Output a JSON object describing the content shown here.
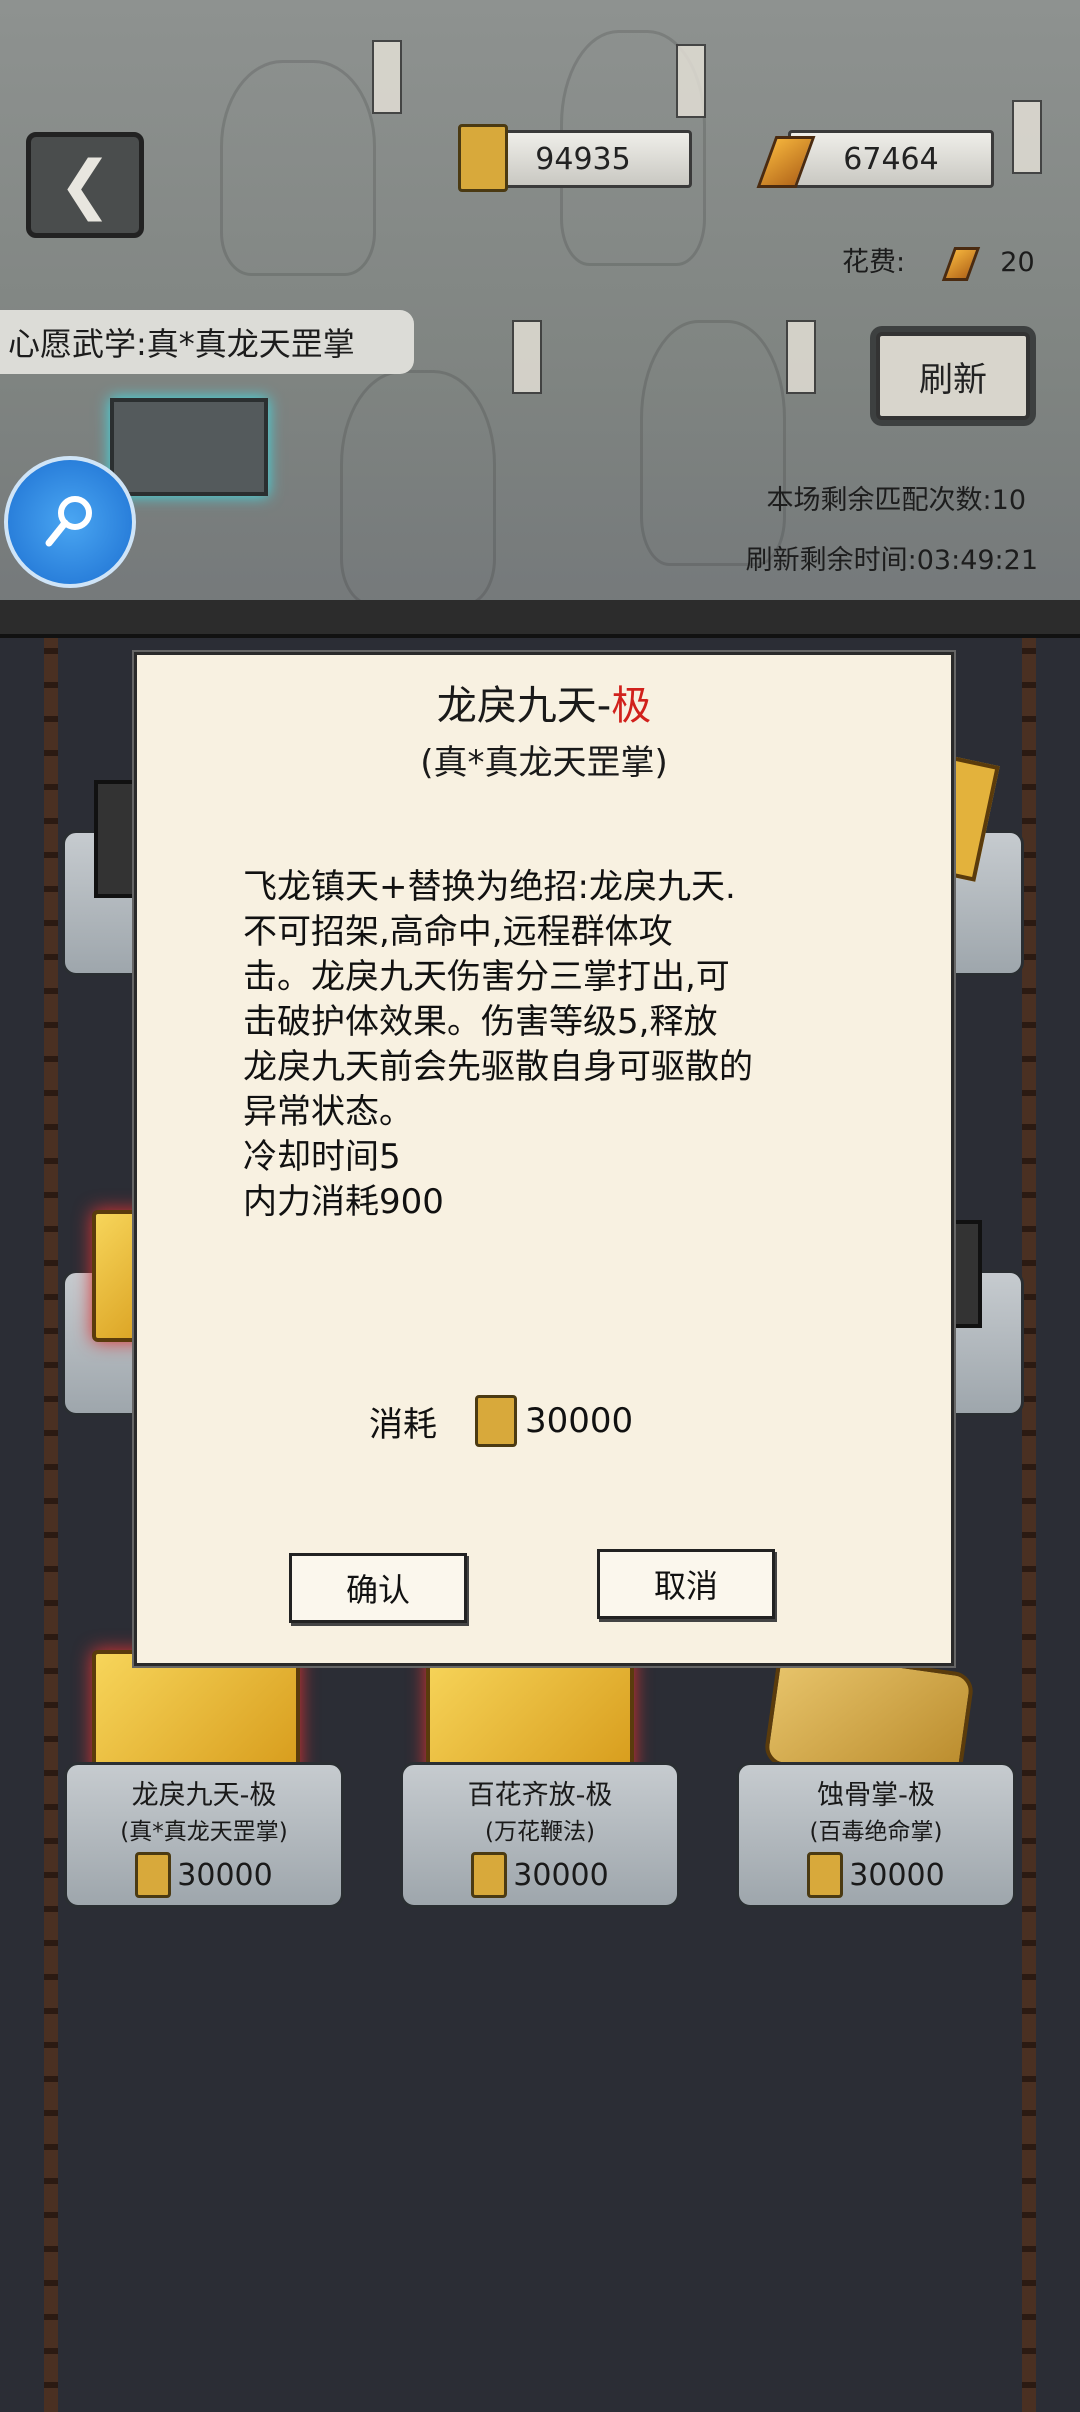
{
  "header": {
    "scroll_count": "94935",
    "gold_count": "67464",
    "cost_label": "花费:",
    "cost_value": "20",
    "refresh_label": "刷新",
    "remaining_matches": "本场剩余匹配次数:10",
    "refresh_timer": "刷新剩余时间:03:49:21"
  },
  "wish": {
    "text": "心愿武学:真*真龙天罡掌"
  },
  "shelf": {
    "items": [
      {
        "name": "龙戾九天-极",
        "school": "(真*真龙天罡掌)",
        "price": "30000"
      },
      {
        "name": "百花齐放-极",
        "school": "(万花鞭法)",
        "price": "30000"
      },
      {
        "name": "蚀骨掌-极",
        "school": "(百毒绝命掌)",
        "price": "30000"
      }
    ]
  },
  "dialog": {
    "title_main": "龙戾九天-",
    "title_tier": "极",
    "subtitle": "(真*真龙天罡掌)",
    "description": "飞龙镇天+替换为绝招:龙戾九天.\n不可招架,高命中,远程群体攻\n击。龙戾九天伤害分三掌打出,可\n击破护体效果。伤害等级5,释放\n龙戾九天前会先驱散自身可驱散的\n异常状态。\n冷却时间5\n内力消耗900",
    "cost_label": "消耗",
    "cost_value": "30000",
    "confirm_label": "确认",
    "cancel_label": "取消"
  },
  "colors": {
    "tier_red": "#d1211c",
    "fab_blue": "#1c6fd1",
    "book_gold": "#e8b53a"
  }
}
